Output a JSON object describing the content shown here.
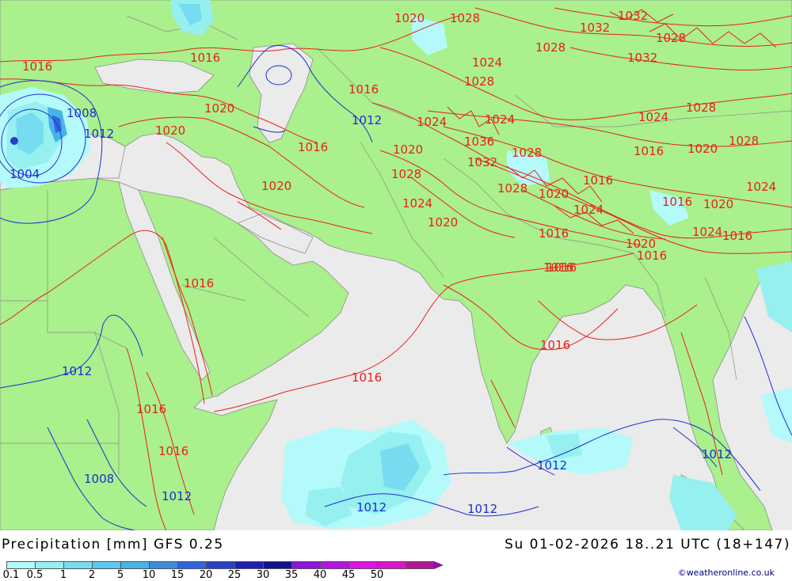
{
  "map": {
    "colors": {
      "land": "#aaf08c",
      "sea": "#ebebeb",
      "isobar_high": "#e8201c",
      "isobar_low": "#1c2ed4",
      "border": "#8c8c8c"
    },
    "isobar_labels": [
      {
        "text": "1020",
        "color": "red"
      },
      {
        "text": "1028",
        "color": "red"
      },
      {
        "text": "1032",
        "color": "red"
      },
      {
        "text": "1032",
        "color": "red"
      },
      {
        "text": "1028",
        "color": "red"
      },
      {
        "text": "1028",
        "color": "red"
      },
      {
        "text": "1032",
        "color": "red"
      },
      {
        "text": "1024",
        "color": "red"
      },
      {
        "text": "1016",
        "color": "red"
      },
      {
        "text": "1016",
        "color": "red"
      },
      {
        "text": "1028",
        "color": "red"
      },
      {
        "text": "1016",
        "color": "red"
      },
      {
        "text": "1020",
        "color": "red"
      },
      {
        "text": "1020",
        "color": "red"
      },
      {
        "text": "1024",
        "color": "red"
      },
      {
        "text": "1024",
        "color": "red"
      },
      {
        "text": "1028",
        "color": "red"
      },
      {
        "text": "1024",
        "color": "red"
      },
      {
        "text": "1016",
        "color": "red"
      },
      {
        "text": "1036",
        "color": "red"
      },
      {
        "text": "1028",
        "color": "red"
      },
      {
        "text": "1020",
        "color": "red"
      },
      {
        "text": "1028",
        "color": "red"
      },
      {
        "text": "1016",
        "color": "red"
      },
      {
        "text": "1020",
        "color": "red"
      },
      {
        "text": "1032",
        "color": "red"
      },
      {
        "text": "1016",
        "color": "red"
      },
      {
        "text": "1028",
        "color": "red"
      },
      {
        "text": "1020",
        "color": "red"
      },
      {
        "text": "1028",
        "color": "red"
      },
      {
        "text": "1020",
        "color": "red"
      },
      {
        "text": "1016",
        "color": "red"
      },
      {
        "text": "1024",
        "color": "red"
      },
      {
        "text": "1024",
        "color": "red"
      },
      {
        "text": "1020",
        "color": "red"
      },
      {
        "text": "1024",
        "color": "red"
      },
      {
        "text": "1016",
        "color": "red"
      },
      {
        "text": "1024",
        "color": "red"
      },
      {
        "text": "1020",
        "color": "red"
      },
      {
        "text": "1020",
        "color": "red"
      },
      {
        "text": "1016",
        "color": "red"
      },
      {
        "text": "1016",
        "color": "red"
      },
      {
        "text": "1016",
        "color": "red"
      },
      {
        "text": "1016",
        "color": "red"
      },
      {
        "text": "1016",
        "color": "red"
      },
      {
        "text": "1016",
        "color": "red"
      },
      {
        "text": "1016",
        "color": "red"
      },
      {
        "text": "1016",
        "color": "red"
      },
      {
        "text": "1016",
        "color": "red"
      },
      {
        "text": "1008",
        "color": "blue"
      },
      {
        "text": "1012",
        "color": "blue"
      },
      {
        "text": "1004",
        "color": "blue"
      },
      {
        "text": "1012",
        "color": "blue"
      },
      {
        "text": "1012",
        "color": "blue"
      },
      {
        "text": "1008",
        "color": "blue"
      },
      {
        "text": "1012",
        "color": "blue"
      },
      {
        "text": "1012",
        "color": "blue"
      },
      {
        "text": "1012",
        "color": "blue"
      },
      {
        "text": "1012",
        "color": "blue"
      },
      {
        "text": "1012",
        "color": "blue"
      }
    ]
  },
  "footer": {
    "title": "Precipitation [mm] GFS 0.25",
    "datetime": "Su 01-02-2026 18..21 UTC (18+147)",
    "credit": "©weatheronline.co.uk",
    "scale": {
      "ticks": [
        "0.1",
        "0.5",
        "1",
        "2",
        "5",
        "10",
        "15",
        "20",
        "25",
        "30",
        "35",
        "40",
        "45",
        "50"
      ],
      "colors": [
        "#b4fafa",
        "#96f0f0",
        "#78dcf0",
        "#5ac8f0",
        "#46b4e6",
        "#3c8cdc",
        "#3264dc",
        "#2840c8",
        "#1e1eb4",
        "#14148c",
        "#8c14dc",
        "#b414e6",
        "#dc14e6",
        "#dc14c8",
        "#b41496"
      ]
    }
  }
}
